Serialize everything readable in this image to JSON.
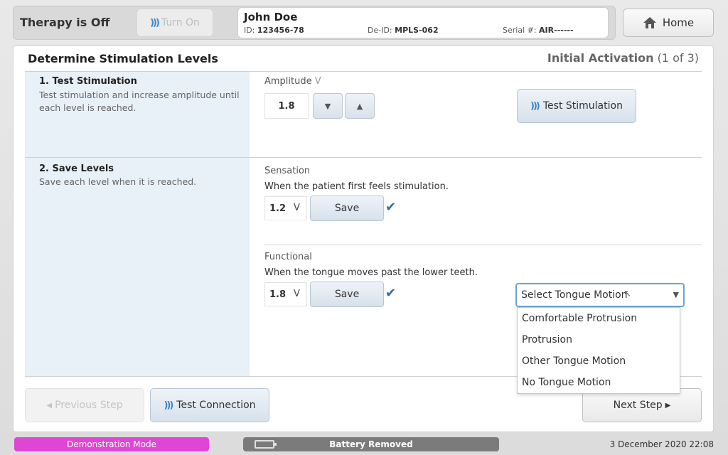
{
  "topbar": {
    "therapy_status": "Therapy is Off",
    "turn_on_label": "Turn On",
    "home_label": "Home"
  },
  "patient": {
    "name": "John Doe",
    "id_label": "ID:",
    "id_value": "123456-78",
    "deid_label": "De-ID:",
    "deid_value": "MPLS-062",
    "serial_label": "Serial #:",
    "serial_value": "AIR------"
  },
  "main": {
    "title": "Determine Stimulation Levels",
    "step_name": "Initial Activation",
    "step_progress": "(1 of 3)"
  },
  "test_stimulation": {
    "title": "1. Test Stimulation",
    "description": "Test stimulation and increase amplitude until each level is reached.",
    "amplitude_label": "Amplitude",
    "amplitude_unit": "V",
    "amplitude_value": "1.8",
    "decrease_symbol": "▼",
    "increase_symbol": "▲",
    "button_label": "Test Stimulation"
  },
  "save_levels": {
    "title": "2. Save Levels",
    "description": "Save each level when it is reached.",
    "sensation": {
      "label": "Sensation",
      "description": "When the patient first feels stimulation.",
      "value": "1.2",
      "unit": "V",
      "save_label": "Save"
    },
    "functional": {
      "label": "Functional",
      "description": "When the tongue moves past the lower teeth.",
      "value": "1.8",
      "unit": "V",
      "save_label": "Save"
    }
  },
  "tongue_motion": {
    "placeholder": "Select Tongue Motion",
    "options": [
      "Comfortable Protrusion",
      "Protrusion",
      "Other Tongue Motion",
      "No Tongue Motion"
    ]
  },
  "footer_buttons": {
    "previous_label": "Previous Step",
    "test_connection_label": "Test Connection",
    "next_label": "Next Step"
  },
  "status_bar": {
    "demo_mode": "Demonstration Mode",
    "battery": "Battery Removed",
    "datetime": "3 December 2020 22:08"
  },
  "colors": {
    "accent": "#3a86c8",
    "demo_badge": "#e046d6",
    "battery_badge": "#7b7b7b",
    "left_panel": "#e8f0f8"
  }
}
